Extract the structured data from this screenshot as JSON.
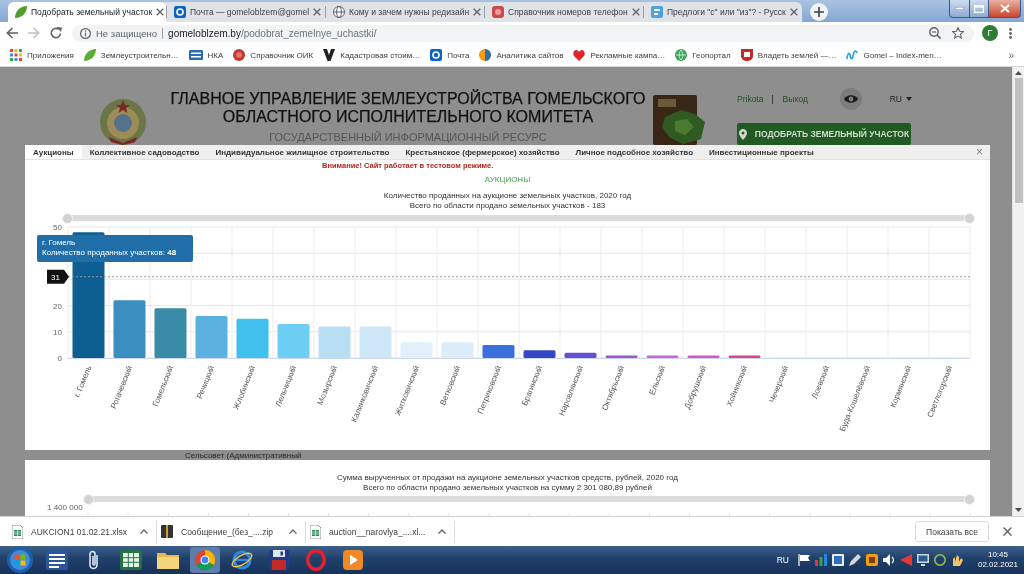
{
  "browser": {
    "tabs": [
      {
        "title": "Подобрать земельный участок",
        "selected": true
      },
      {
        "title": "Почта — gomeloblzem@gomel",
        "selected": false
      },
      {
        "title": "Кому и зачем нужны редизайн",
        "selected": false
      },
      {
        "title": "Справочник номеров телефон",
        "selected": false
      },
      {
        "title": "Предлоги \"с\" или \"из\"? - Русск",
        "selected": false
      }
    ],
    "address_bar": {
      "security": "Не защищено",
      "url": "**gomeloblzem.by**/podobrat_zemelnye_uchastki/"
    },
    "profile_initial": "Г",
    "bookmarks": [
      {
        "label": "Приложения"
      },
      {
        "label": "Землеустроительн…"
      },
      {
        "label": "НКА"
      },
      {
        "label": "Справочник ОИК"
      },
      {
        "label": "Кадастровая стоим…"
      },
      {
        "label": "Почта"
      },
      {
        "label": "Аналитика сайтов"
      },
      {
        "label": "Рекламные кампа…"
      },
      {
        "label": "Геопортал"
      },
      {
        "label": "Владеть землей —…"
      },
      {
        "label": "Gomel – Index-men…"
      }
    ],
    "bookmarks_overflow": "»"
  },
  "site_header": {
    "title": "ГЛАВНОЕ УПРАВЛЕНИЕ ЗЕМЛЕУСТРОЙСТВА ГОМЕЛЬСКОГО ОБЛАСТНОГО ИСПОЛНИТЕЛЬНОГО КОМИТЕТА",
    "subtitle": "ГОСУДАРСТВЕННЫЙ ИНФОРМАЦИОННЫЙ РЕСУРС",
    "user": "Prikota",
    "logout": "Выход",
    "language": "RU",
    "cta_button": "ПОДОБРАТЬ ЗЕМЕЛЬНЫЙ УЧАСТОК",
    "notice": "Внимание! Сайт работает в тестовом режиме."
  },
  "modal": {
    "tabs": [
      {
        "label": "Аукционы",
        "selected": true
      },
      {
        "label": "Коллективное садоводство",
        "selected": false
      },
      {
        "label": "Индивидуальное жилищное строительство",
        "selected": false
      },
      {
        "label": "Крестьянское (фермерское) хозяйство",
        "selected": false
      },
      {
        "label": "Личное подсобное хозяйство",
        "selected": false
      },
      {
        "label": "Инвестиционные проекты",
        "selected": false
      }
    ],
    "close": "×"
  },
  "auction_panel": {
    "heading": "АУКЦИОНЫ",
    "subtitle": "Всего по области продано земельных участков - 183",
    "range_slider": {
      "level": 1
    },
    "tooltip": {
      "title": "г. Гомель",
      "text": "Количество проданных участков: **48**"
    },
    "chart_data": {
      "type": "bar",
      "title": "Количество проданных на аукционе земельных участков, 2020 год",
      "categories": [
        "г. Гомель",
        "Рогачевский",
        "Гомельский",
        "Речицкий",
        "Жлобинский",
        "Лельчицкий",
        "Мозырский",
        "Калинковичский",
        "Житковичский",
        "Ветковский",
        "Петриковский",
        "Брагинский",
        "Наровлянский",
        "Октябрьский",
        "Ельский",
        "Добрушский",
        "Хойникский",
        "Чечерский",
        "Лоевский",
        "Буда-Кошелёвский",
        "Кормянский",
        "Светлогорский"
      ],
      "values": [
        48,
        22,
        19,
        16,
        15,
        13,
        12,
        12,
        6,
        6,
        5,
        3,
        2,
        1,
        1,
        1,
        1,
        0,
        0,
        0,
        0,
        0
      ],
      "ylim": [
        0,
        50
      ],
      "yticks": [
        0,
        10,
        20,
        50
      ],
      "ref_lines": [
        {
          "axis": "y",
          "value": 31,
          "label": "31"
        }
      ]
    }
  },
  "background_strip": {
    "text": "Сельсовет (Административный"
  },
  "revenue_panel": {
    "title": "Сумма вырученных от продажи на аукционе земельных участков средств, рублей, 2020 год",
    "subtitle": "Всего по области продано земельных участков на сумму 2 301 080,89 рублей",
    "top_tick": "1 400 000",
    "range_slider": {
      "level": 1
    }
  },
  "downloads": {
    "items": [
      {
        "name": "AUKCION1 01.02.21.xlsx"
      },
      {
        "name": "Сообщение_(без_....zip"
      },
      {
        "name": "auction__narovlya_....xl..."
      }
    ],
    "show_all": "Показать все"
  },
  "taskbar": {
    "language": "RU",
    "time": "10:45",
    "date": "02.02.2021"
  }
}
